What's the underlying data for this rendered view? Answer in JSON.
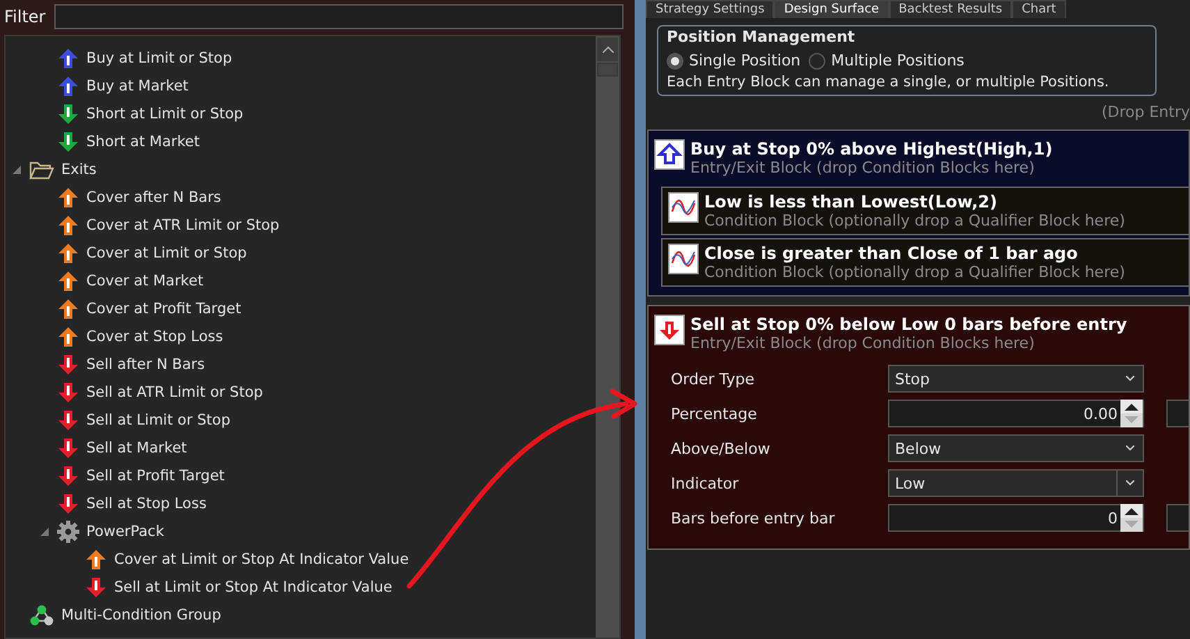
{
  "filter": {
    "label": "Filter"
  },
  "tree": [
    {
      "children": [
        {
          "label": "Buy at Limit or Stop",
          "kind": "up-blue"
        },
        {
          "label": "Buy at Market",
          "kind": "up-blue"
        },
        {
          "label": "Short at Limit or Stop",
          "kind": "down-green"
        },
        {
          "label": "Short at Market",
          "kind": "down-green"
        }
      ]
    },
    {
      "label": "Exits",
      "kind": "folder",
      "expanded": true,
      "children": [
        {
          "label": "Cover after N Bars",
          "kind": "up-orange"
        },
        {
          "label": "Cover at ATR Limit or Stop",
          "kind": "up-orange"
        },
        {
          "label": "Cover at Limit or Stop",
          "kind": "up-orange"
        },
        {
          "label": "Cover at Market",
          "kind": "up-orange"
        },
        {
          "label": "Cover at Profit Target",
          "kind": "up-orange"
        },
        {
          "label": "Cover at Stop Loss",
          "kind": "up-orange"
        },
        {
          "label": "Sell after N Bars",
          "kind": "down-red"
        },
        {
          "label": "Sell at ATR Limit or Stop",
          "kind": "down-red"
        },
        {
          "label": "Sell at Limit or Stop",
          "kind": "down-red"
        },
        {
          "label": "Sell at Market",
          "kind": "down-red"
        },
        {
          "label": "Sell at Profit Target",
          "kind": "down-red"
        },
        {
          "label": "Sell at Stop Loss",
          "kind": "down-red"
        },
        {
          "label": "PowerPack",
          "kind": "gear",
          "expanded": true,
          "children": [
            {
              "label": "Cover at Limit or Stop At Indicator Value",
              "kind": "up-orange"
            },
            {
              "label": "Sell at Limit or Stop At Indicator Value",
              "kind": "down-red"
            }
          ]
        }
      ]
    },
    {
      "label": "Multi-Condition Group",
      "kind": "group"
    }
  ],
  "tabs": [
    {
      "label": "Strategy Settings",
      "selected": false
    },
    {
      "label": "Design Surface",
      "selected": true
    },
    {
      "label": "Backtest Results",
      "selected": false
    },
    {
      "label": "Chart",
      "selected": false
    }
  ],
  "position_management": {
    "title": "Position Management",
    "options": [
      {
        "label": "Single Position",
        "selected": true
      },
      {
        "label": "Multiple Positions",
        "selected": false
      }
    ],
    "note": "Each Entry Block can manage a single, or multiple Positions."
  },
  "drop_hint": "(Drop Entry",
  "blocks": [
    {
      "kind": "entry",
      "title": "Buy at Stop 0% above Highest(High,1)",
      "subtitle": "Entry/Exit Block (drop Condition Blocks here)",
      "conditions": [
        {
          "title": "Low is less than Lowest(Low,2)",
          "subtitle": "Condition Block (optionally drop a Qualifier Block here)"
        },
        {
          "title": "Close is greater than Close of 1 bar ago",
          "subtitle": "Condition Block (optionally drop a Qualifier Block here)"
        }
      ]
    },
    {
      "kind": "exit",
      "title": "Sell at Stop 0% below Low 0 bars before entry",
      "subtitle": "Entry/Exit Block (drop Condition Blocks here)",
      "params": [
        {
          "label": "Order Type",
          "kind": "dropdown",
          "value": "Stop"
        },
        {
          "label": "Percentage",
          "kind": "spinner",
          "value": "0.00"
        },
        {
          "label": "Above/Below",
          "kind": "dropdown",
          "value": "Below"
        },
        {
          "label": "Indicator",
          "kind": "combo",
          "value": "Low"
        },
        {
          "label": "Bars before entry bar",
          "kind": "spinner",
          "value": "0"
        }
      ]
    }
  ]
}
